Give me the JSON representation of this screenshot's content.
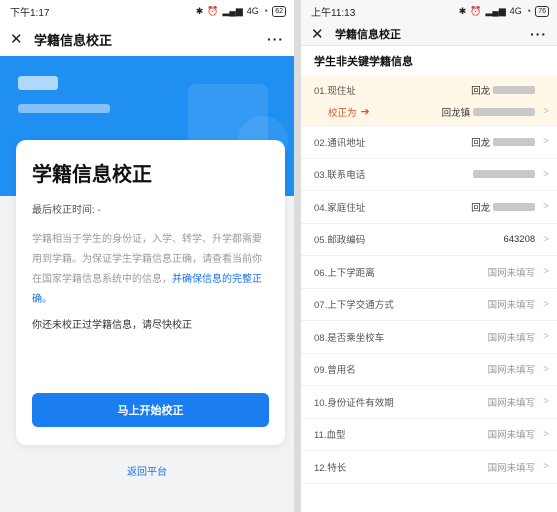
{
  "left": {
    "status": {
      "time": "下午1:17",
      "network": "4G",
      "battery": "62"
    },
    "nav": {
      "title": "学籍信息校正",
      "more": "···"
    },
    "card": {
      "title": "学籍信息校正",
      "last_time": "最后校正时间: -",
      "desc_plain": "学籍相当于学生的身份证，入学、转学、升学都需要用到学籍。为保证学生学籍信息正确，请查看当前你在国家学籍信息系统中的信息，",
      "desc_highlight": "并确保信息的完整正确。",
      "note": "你还未校正过学籍信息，请尽快校正",
      "button": "马上开始校正"
    },
    "back_link": "返回平台"
  },
  "right": {
    "status": {
      "time": "上午11:13",
      "network": "4G",
      "battery": "76"
    },
    "nav": {
      "title": "学籍信息校正",
      "more": "···"
    },
    "section_title": "学生非关键学籍信息",
    "first_row": {
      "label": "01.现住址",
      "value": "回龙",
      "correct_label": "校正为",
      "correct_value": "回龙镇"
    },
    "rows": [
      {
        "label": "02.通讯地址",
        "value": "回龙"
      },
      {
        "label": "03.联系电话",
        "value": ""
      },
      {
        "label": "04.家庭住址",
        "value": "回龙"
      },
      {
        "label": "05.邮政编码",
        "value": "643208"
      },
      {
        "label": "06.上下学距离",
        "value": "国网未填写"
      },
      {
        "label": "07.上下学交通方式",
        "value": "国网未填写"
      },
      {
        "label": "08.是否乘坐校车",
        "value": "国网未填写"
      },
      {
        "label": "09.曾用名",
        "value": "国网未填写"
      },
      {
        "label": "10.身份证件有效期",
        "value": "国网未填写"
      },
      {
        "label": "11.血型",
        "value": "国网未填写"
      },
      {
        "label": "12.特长",
        "value": "国网未填写"
      }
    ]
  },
  "icons": [
    "bluetooth-icon",
    "alarm-icon",
    "signal-icon",
    "wifi-icon",
    "battery-icon",
    "close-icon",
    "more-icon",
    "chevron-right-icon",
    "arrow-right-icon"
  ],
  "colors": {
    "primary": "#1a7df0",
    "banner": "#1f8ff2",
    "link": "#1a73e8",
    "warning": "#e0502a",
    "highlight_row": "#fff8e8"
  }
}
